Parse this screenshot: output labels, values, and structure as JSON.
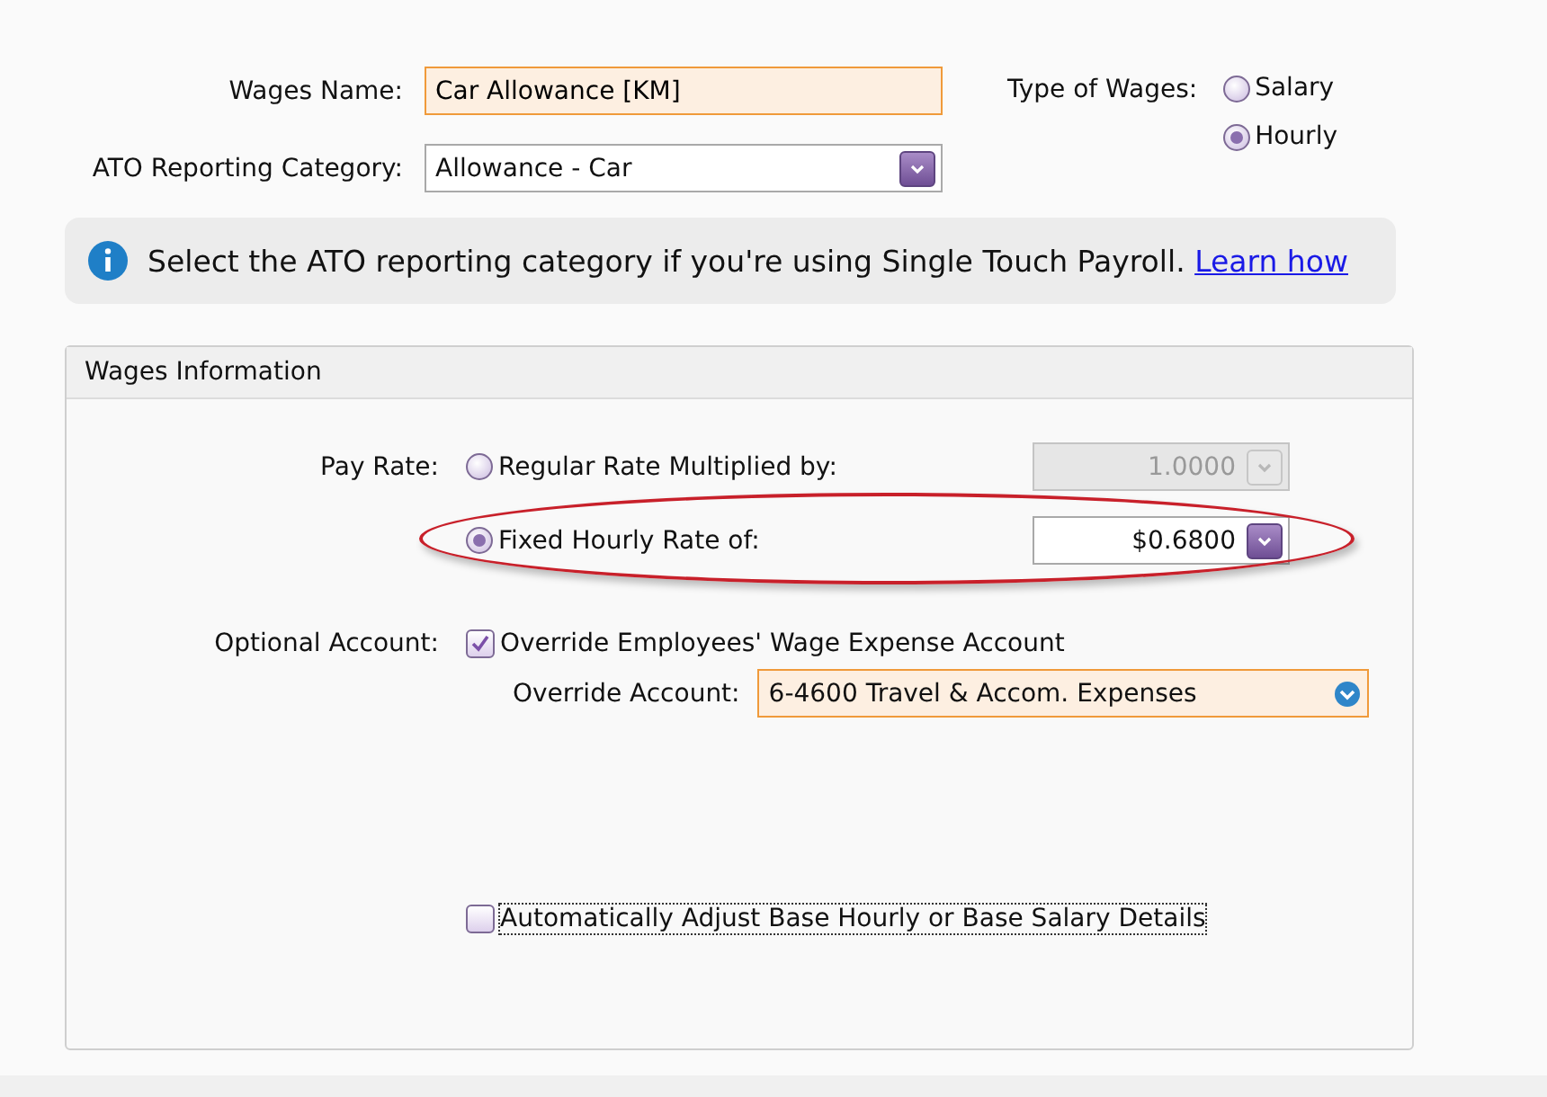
{
  "header": {
    "wages_name": {
      "label": "Wages Name:",
      "value": "Car Allowance [KM]"
    },
    "ato_category": {
      "label": "ATO Reporting Category:",
      "value": "Allowance - Car"
    },
    "type_of_wages": {
      "label": "Type of Wages:",
      "options": [
        {
          "label": "Salary",
          "selected": false
        },
        {
          "label": "Hourly",
          "selected": true
        }
      ]
    }
  },
  "info": {
    "text": "Select the ATO reporting category if you're using Single Touch Payroll.",
    "link": "Learn how"
  },
  "panel": {
    "title": "Wages Information",
    "pay_rate": {
      "label": "Pay Rate:",
      "options": [
        {
          "label": "Regular Rate Multiplied by:",
          "selected": false,
          "value": "1.0000",
          "disabled": true,
          "highlighted": false
        },
        {
          "label": "Fixed Hourly Rate of:",
          "selected": true,
          "value": "$0.6800",
          "disabled": false,
          "highlighted": true
        }
      ]
    },
    "optional_account": {
      "label": "Optional Account:",
      "checkbox": {
        "label": "Override Employees' Wage Expense Account",
        "checked": true
      }
    },
    "override_account": {
      "label": "Override Account:",
      "value": "6-4600 Travel & Accom. Expenses"
    },
    "auto_adjust": {
      "label": "Automatically Adjust Base Hourly or Base Salary Details",
      "checked": false
    }
  }
}
